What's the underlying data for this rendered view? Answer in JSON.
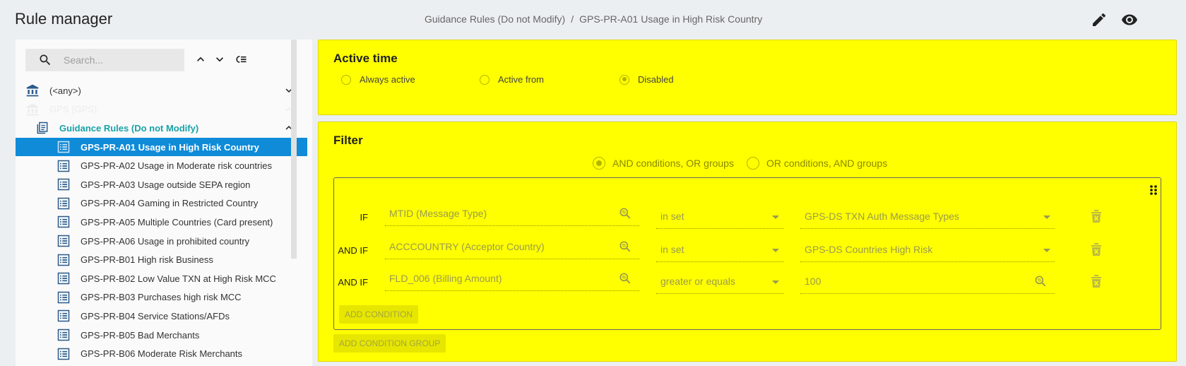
{
  "app": {
    "title": "Rule manager",
    "breadcrumb": [
      "Guidance Rules (Do not Modify)",
      "GPS-PR-A01 Usage in High Risk Country"
    ],
    "breadcrumb_separator": "/",
    "actions": {
      "edit_icon": "pencil-icon",
      "view_icon": "eye-icon"
    }
  },
  "sidebar": {
    "search": {
      "placeholder": "Search...",
      "value": ""
    },
    "tree": [
      {
        "label": "(<any>)",
        "icon": "bank-icon",
        "level": 0,
        "expand": "down"
      },
      {
        "label": "GPS (GPS)",
        "icon": "bank-icon",
        "level": 0,
        "expand": "up",
        "faded": true
      },
      {
        "label": "Guidance Rules (Do not Modify)",
        "icon": "folder-doc-icon",
        "level": 1,
        "expand": "up"
      },
      {
        "label": "GPS-PR-A01 Usage in High Risk Country",
        "icon": "list-doc-icon",
        "level": 2,
        "selected": true
      },
      {
        "label": "GPS-PR-A02 Usage in Moderate risk countries",
        "icon": "list-doc-icon",
        "level": 2
      },
      {
        "label": "GPS-PR-A03 Usage outside SEPA region",
        "icon": "list-doc-icon",
        "level": 2
      },
      {
        "label": "GPS-PR-A04 Gaming in Restricted Country",
        "icon": "list-doc-icon",
        "level": 2
      },
      {
        "label": "GPS-PR-A05 Multiple Countries (Card present)",
        "icon": "list-doc-icon",
        "level": 2
      },
      {
        "label": "GPS-PR-A06 Usage in prohibited country",
        "icon": "list-doc-icon",
        "level": 2
      },
      {
        "label": "GPS-PR-B01 High risk Business",
        "icon": "list-doc-icon",
        "level": 2
      },
      {
        "label": "GPS-PR-B02 Low Value TXN at High Risk MCC",
        "icon": "list-doc-icon",
        "level": 2
      },
      {
        "label": "GPS-PR-B03 Purchases high risk MCC",
        "icon": "list-doc-icon",
        "level": 2
      },
      {
        "label": "GPS-PR-B04 Service Stations/AFDs",
        "icon": "list-doc-icon",
        "level": 2
      },
      {
        "label": "GPS-PR-B05 Bad Merchants",
        "icon": "list-doc-icon",
        "level": 2
      },
      {
        "label": "GPS-PR-B06 Moderate Risk Merchants",
        "icon": "list-doc-icon",
        "level": 2
      }
    ]
  },
  "active_time": {
    "title": "Active time",
    "options": [
      "Always active",
      "Active from",
      "Disabled"
    ],
    "selected": "Disabled"
  },
  "filter": {
    "title": "Filter",
    "mode_options": [
      "AND conditions, OR groups",
      "OR conditions, AND groups"
    ],
    "mode_selected": "AND conditions, OR groups",
    "conditions": [
      {
        "prefix": "IF",
        "field": "MTID (Message Type)",
        "operator": "in set",
        "value": "GPS-DS TXN Auth Message Types",
        "value_kind": "select"
      },
      {
        "prefix": "AND IF",
        "field": "ACCCOUNTRY (Acceptor Country)",
        "operator": "in set",
        "value": "GPS-DS Countries High Risk",
        "value_kind": "select"
      },
      {
        "prefix": "AND IF",
        "field": "FLD_006 (Billing Amount)",
        "operator": "greater or equals",
        "value": "100",
        "value_kind": "lookup"
      }
    ],
    "add_condition_label": "ADD CONDITION",
    "add_group_label": "ADD CONDITION GROUP"
  },
  "colors": {
    "panel_bg": "#ffff00",
    "selected_bg": "#0f8bd8",
    "teal_accent": "#17a2a8"
  }
}
